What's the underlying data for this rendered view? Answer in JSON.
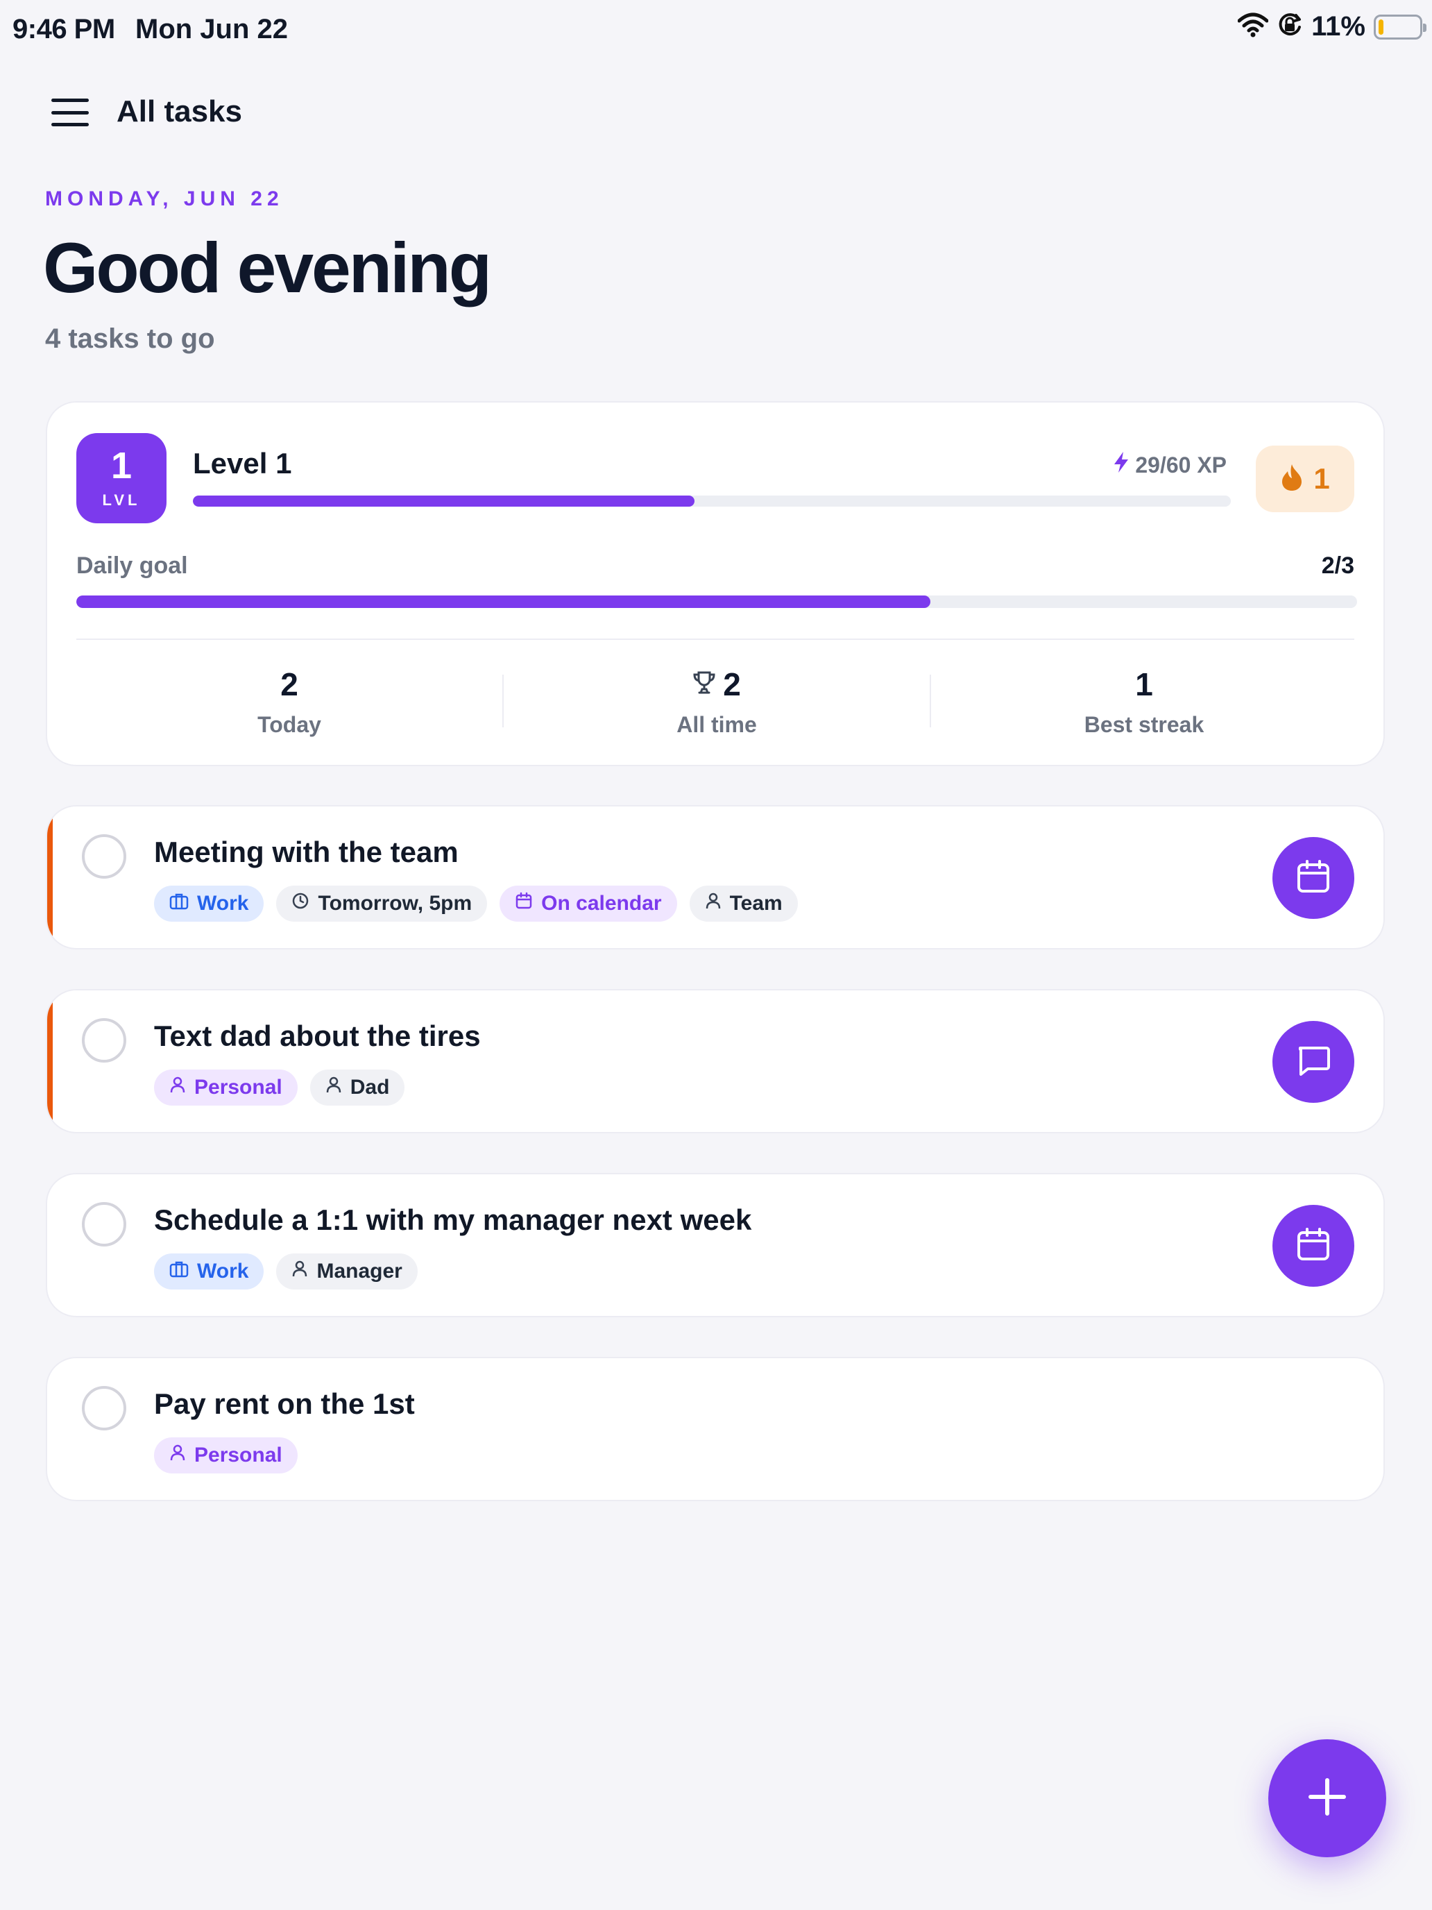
{
  "status_bar": {
    "time": "9:46 PM",
    "date": "Mon Jun 22",
    "battery_pct": "11%",
    "battery_level": 0.11,
    "icons": [
      "wifi-icon",
      "orientation-lock-icon",
      "battery-icon"
    ]
  },
  "header": {
    "title": "All tasks",
    "menu_icon": "hamburger-menu-icon"
  },
  "hero": {
    "date_label": "MONDAY, JUN 22",
    "greeting": "Good evening",
    "subtitle": "4 tasks to go"
  },
  "stats": {
    "level_number": "1",
    "level_badge_label": "LVL",
    "level_title": "Level 1",
    "xp_text": "29/60 XP",
    "xp_progress": 0.4833,
    "streak_value": "1",
    "daily_goal_label": "Daily goal",
    "daily_goal_value": "2/3",
    "daily_goal_progress": 0.6667,
    "columns": [
      {
        "value": "2",
        "label": "Today"
      },
      {
        "value": "2",
        "label": "All time",
        "icon": "trophy-icon"
      },
      {
        "value": "1",
        "label": "Best streak"
      }
    ]
  },
  "tasks": [
    {
      "title": "Meeting with the team",
      "priority_accent": true,
      "tags": [
        {
          "label": "Work",
          "icon": "briefcase-icon",
          "style": "blue"
        },
        {
          "label": "Tomorrow, 5pm",
          "icon": "clock-icon",
          "style": "gray"
        },
        {
          "label": "On calendar",
          "icon": "calendar-icon",
          "style": "purple"
        },
        {
          "label": "Team",
          "icon": "person-icon",
          "style": "gray"
        }
      ],
      "action_icon": "calendar-icon"
    },
    {
      "title": "Text dad about the tires",
      "priority_accent": true,
      "tags": [
        {
          "label": "Personal",
          "icon": "person-icon",
          "style": "purple"
        },
        {
          "label": "Dad",
          "icon": "person-icon",
          "style": "gray"
        }
      ],
      "action_icon": "message-icon"
    },
    {
      "title": "Schedule a 1:1 with my manager next week",
      "priority_accent": false,
      "tags": [
        {
          "label": "Work",
          "icon": "briefcase-icon",
          "style": "blue"
        },
        {
          "label": "Manager",
          "icon": "person-icon",
          "style": "gray"
        }
      ],
      "action_icon": "calendar-icon"
    },
    {
      "title": "Pay rent on the 1st",
      "priority_accent": false,
      "tags": [
        {
          "label": "Personal",
          "icon": "person-icon",
          "style": "purple"
        }
      ],
      "action_icon": null
    }
  ],
  "fab_icon": "plus-icon",
  "colors": {
    "accent": "#7c3aed",
    "priority": "#ea580c",
    "streak": "#e07b13",
    "background": "#f5f5f9"
  }
}
